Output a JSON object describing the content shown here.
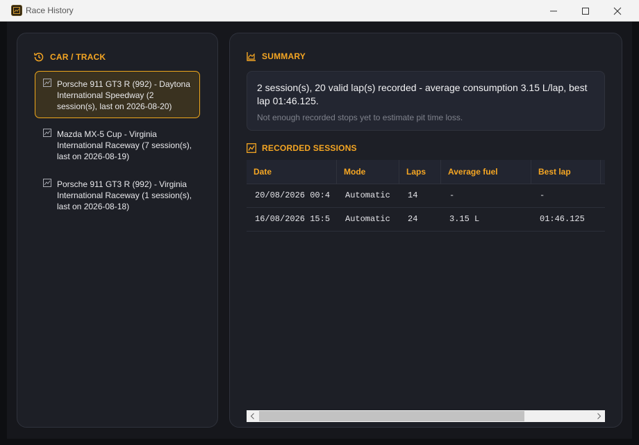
{
  "window": {
    "title": "Race History"
  },
  "sidebar": {
    "title": "CAR / TRACK",
    "items": [
      {
        "label": "Porsche 911 GT3 R (992) - Daytona International Speedway (2 session(s), last on 2026-08-20)",
        "selected": true
      },
      {
        "label": "Mazda MX-5 Cup - Virginia International Raceway (7 session(s), last on 2026-08-19)",
        "selected": false
      },
      {
        "label": "Porsche 911 GT3 R (992) - Virginia International Raceway (1 session(s), last on 2026-08-18)",
        "selected": false
      }
    ]
  },
  "summary": {
    "title": "SUMMARY",
    "text": "2 session(s), 20 valid lap(s) recorded - average consumption 3.15 L/lap, best lap 01:46.125.",
    "note": "Not enough recorded stops yet to estimate pit time loss."
  },
  "sessions": {
    "title": "RECORDED SESSIONS",
    "columns": [
      "Date",
      "Mode",
      "Laps",
      "Average fuel",
      "Best lap"
    ],
    "rows": [
      {
        "date": "20/08/2026 00:4",
        "mode": "Automatic",
        "laps": "14",
        "fuel": "-",
        "best": "-"
      },
      {
        "date": "16/08/2026 15:5",
        "mode": "Automatic",
        "laps": "24",
        "fuel": "3.15 L",
        "best": "01:46.125"
      }
    ]
  },
  "colors": {
    "accent": "#f5a623",
    "selected_bg": "#3a3220",
    "panel_bg": "#1d1f26"
  },
  "icons": {
    "app": "chart-icon",
    "history": "history-icon",
    "summary": "area-chart-icon",
    "sessions": "line-chart-icon",
    "list_item": "chart-icon"
  }
}
